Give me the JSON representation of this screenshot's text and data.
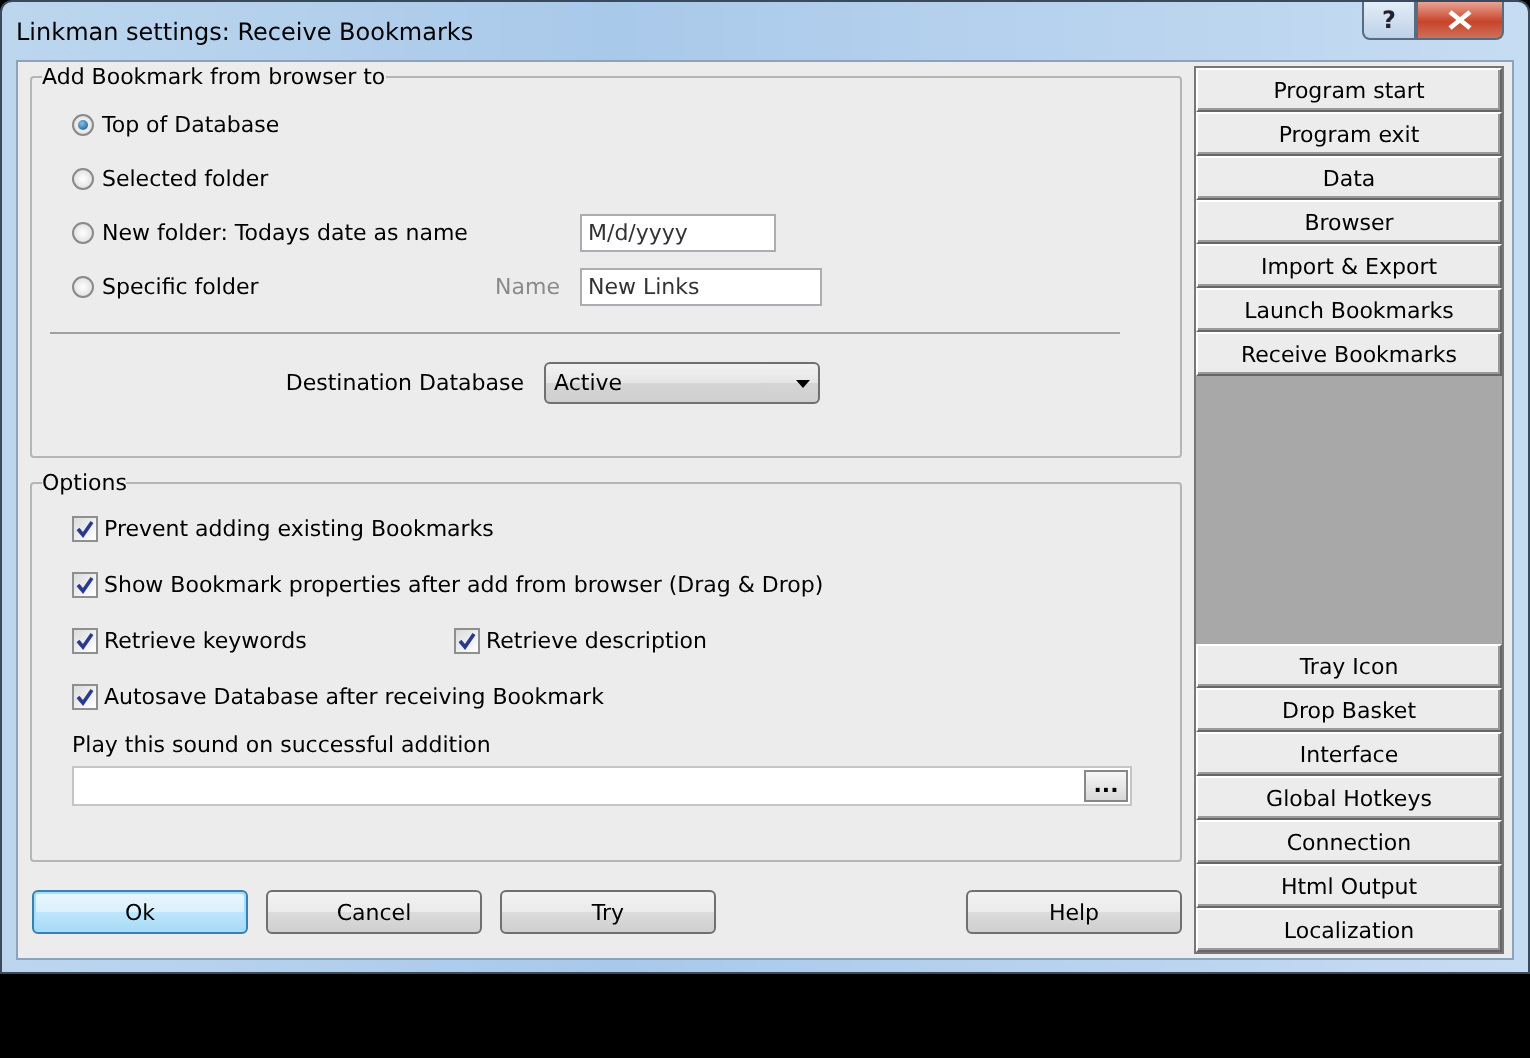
{
  "window": {
    "title": "Linkman settings: Receive Bookmarks",
    "help_glyph": "?"
  },
  "placement": {
    "title": "Add Bookmark from browser to",
    "options": [
      {
        "label": "Top of Database",
        "selected": true
      },
      {
        "label": "Selected folder",
        "selected": false
      },
      {
        "label": "New folder: Todays date as name",
        "selected": false,
        "field": {
          "value": "M/d/yyyy"
        }
      },
      {
        "label": "Specific folder",
        "selected": false,
        "field_label": "Name",
        "field": {
          "value": "New Links"
        }
      }
    ],
    "destination": {
      "label": "Destination Database",
      "value": "Active"
    }
  },
  "options": {
    "title": "Options",
    "rows": [
      [
        {
          "label": "Prevent adding existing Bookmarks",
          "checked": true
        }
      ],
      [
        {
          "label": "Show Bookmark properties after add from browser (Drag & Drop)",
          "checked": true
        }
      ],
      [
        {
          "label": "Retrieve keywords",
          "checked": true
        },
        {
          "label": "Retrieve description",
          "checked": true
        }
      ],
      [
        {
          "label": "Autosave Database after receiving Bookmark",
          "checked": true
        }
      ]
    ],
    "sound": {
      "label": "Play this sound on successful addition",
      "browse": "..."
    }
  },
  "buttons": [
    {
      "label": "Ok",
      "default": true
    },
    {
      "label": "Cancel",
      "default": false
    },
    {
      "label": "Try",
      "default": false
    }
  ],
  "help_button": {
    "label": "Help"
  },
  "sidebar": {
    "top_items": [
      "Program start",
      "Program exit",
      "Data",
      "Browser",
      "Import & Export",
      "Launch Bookmarks",
      "Receive Bookmarks"
    ],
    "bottom_items": [
      "Tray Icon",
      "Drop Basket",
      "Interface",
      "Global Hotkeys",
      "Connection",
      "Html Output",
      "Localization"
    ]
  }
}
